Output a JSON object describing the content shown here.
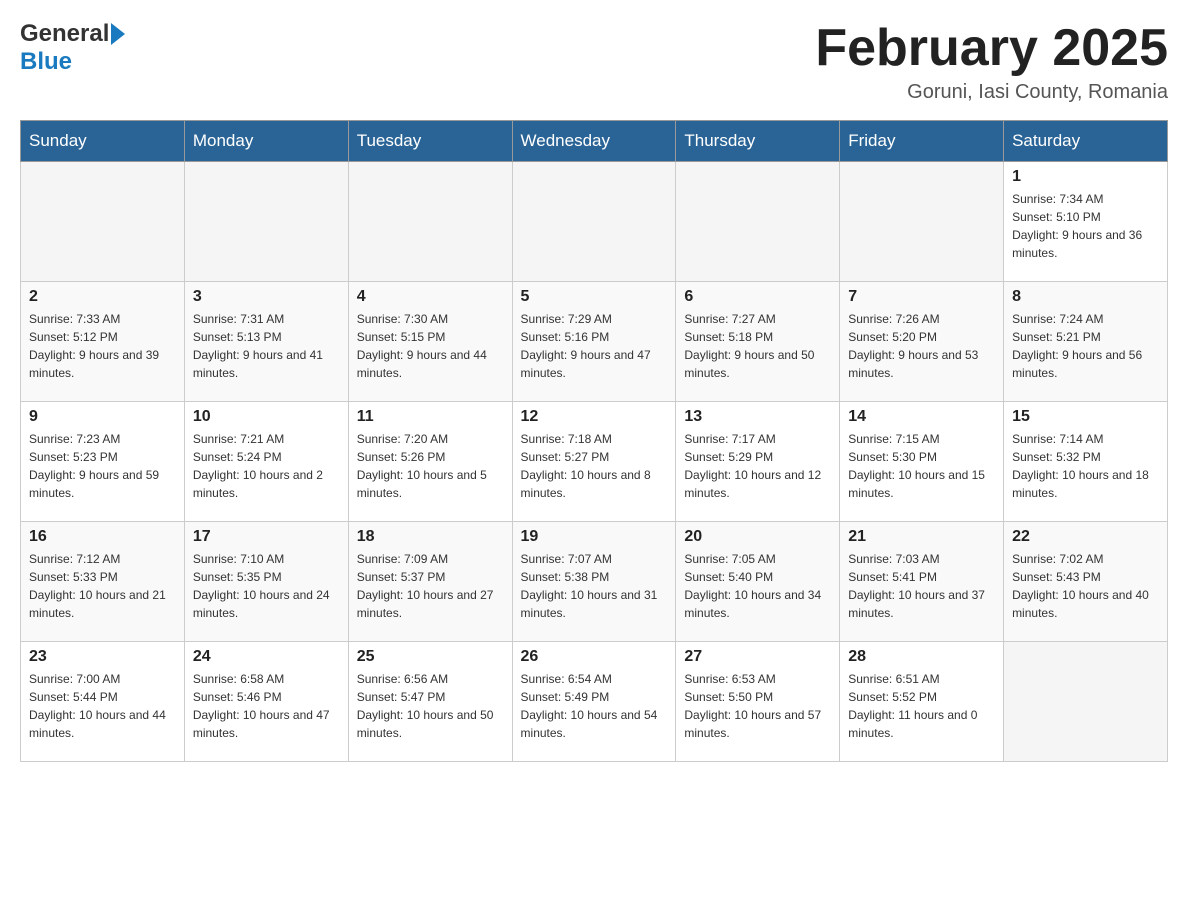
{
  "header": {
    "title": "February 2025",
    "location": "Goruni, Iasi County, Romania",
    "logo_general": "General",
    "logo_blue": "Blue"
  },
  "weekdays": [
    "Sunday",
    "Monday",
    "Tuesday",
    "Wednesday",
    "Thursday",
    "Friday",
    "Saturday"
  ],
  "rows": [
    [
      {
        "day": "",
        "info": ""
      },
      {
        "day": "",
        "info": ""
      },
      {
        "day": "",
        "info": ""
      },
      {
        "day": "",
        "info": ""
      },
      {
        "day": "",
        "info": ""
      },
      {
        "day": "",
        "info": ""
      },
      {
        "day": "1",
        "info": "Sunrise: 7:34 AM\nSunset: 5:10 PM\nDaylight: 9 hours and 36 minutes."
      }
    ],
    [
      {
        "day": "2",
        "info": "Sunrise: 7:33 AM\nSunset: 5:12 PM\nDaylight: 9 hours and 39 minutes."
      },
      {
        "day": "3",
        "info": "Sunrise: 7:31 AM\nSunset: 5:13 PM\nDaylight: 9 hours and 41 minutes."
      },
      {
        "day": "4",
        "info": "Sunrise: 7:30 AM\nSunset: 5:15 PM\nDaylight: 9 hours and 44 minutes."
      },
      {
        "day": "5",
        "info": "Sunrise: 7:29 AM\nSunset: 5:16 PM\nDaylight: 9 hours and 47 minutes."
      },
      {
        "day": "6",
        "info": "Sunrise: 7:27 AM\nSunset: 5:18 PM\nDaylight: 9 hours and 50 minutes."
      },
      {
        "day": "7",
        "info": "Sunrise: 7:26 AM\nSunset: 5:20 PM\nDaylight: 9 hours and 53 minutes."
      },
      {
        "day": "8",
        "info": "Sunrise: 7:24 AM\nSunset: 5:21 PM\nDaylight: 9 hours and 56 minutes."
      }
    ],
    [
      {
        "day": "9",
        "info": "Sunrise: 7:23 AM\nSunset: 5:23 PM\nDaylight: 9 hours and 59 minutes."
      },
      {
        "day": "10",
        "info": "Sunrise: 7:21 AM\nSunset: 5:24 PM\nDaylight: 10 hours and 2 minutes."
      },
      {
        "day": "11",
        "info": "Sunrise: 7:20 AM\nSunset: 5:26 PM\nDaylight: 10 hours and 5 minutes."
      },
      {
        "day": "12",
        "info": "Sunrise: 7:18 AM\nSunset: 5:27 PM\nDaylight: 10 hours and 8 minutes."
      },
      {
        "day": "13",
        "info": "Sunrise: 7:17 AM\nSunset: 5:29 PM\nDaylight: 10 hours and 12 minutes."
      },
      {
        "day": "14",
        "info": "Sunrise: 7:15 AM\nSunset: 5:30 PM\nDaylight: 10 hours and 15 minutes."
      },
      {
        "day": "15",
        "info": "Sunrise: 7:14 AM\nSunset: 5:32 PM\nDaylight: 10 hours and 18 minutes."
      }
    ],
    [
      {
        "day": "16",
        "info": "Sunrise: 7:12 AM\nSunset: 5:33 PM\nDaylight: 10 hours and 21 minutes."
      },
      {
        "day": "17",
        "info": "Sunrise: 7:10 AM\nSunset: 5:35 PM\nDaylight: 10 hours and 24 minutes."
      },
      {
        "day": "18",
        "info": "Sunrise: 7:09 AM\nSunset: 5:37 PM\nDaylight: 10 hours and 27 minutes."
      },
      {
        "day": "19",
        "info": "Sunrise: 7:07 AM\nSunset: 5:38 PM\nDaylight: 10 hours and 31 minutes."
      },
      {
        "day": "20",
        "info": "Sunrise: 7:05 AM\nSunset: 5:40 PM\nDaylight: 10 hours and 34 minutes."
      },
      {
        "day": "21",
        "info": "Sunrise: 7:03 AM\nSunset: 5:41 PM\nDaylight: 10 hours and 37 minutes."
      },
      {
        "day": "22",
        "info": "Sunrise: 7:02 AM\nSunset: 5:43 PM\nDaylight: 10 hours and 40 minutes."
      }
    ],
    [
      {
        "day": "23",
        "info": "Sunrise: 7:00 AM\nSunset: 5:44 PM\nDaylight: 10 hours and 44 minutes."
      },
      {
        "day": "24",
        "info": "Sunrise: 6:58 AM\nSunset: 5:46 PM\nDaylight: 10 hours and 47 minutes."
      },
      {
        "day": "25",
        "info": "Sunrise: 6:56 AM\nSunset: 5:47 PM\nDaylight: 10 hours and 50 minutes."
      },
      {
        "day": "26",
        "info": "Sunrise: 6:54 AM\nSunset: 5:49 PM\nDaylight: 10 hours and 54 minutes."
      },
      {
        "day": "27",
        "info": "Sunrise: 6:53 AM\nSunset: 5:50 PM\nDaylight: 10 hours and 57 minutes."
      },
      {
        "day": "28",
        "info": "Sunrise: 6:51 AM\nSunset: 5:52 PM\nDaylight: 11 hours and 0 minutes."
      },
      {
        "day": "",
        "info": ""
      }
    ]
  ]
}
